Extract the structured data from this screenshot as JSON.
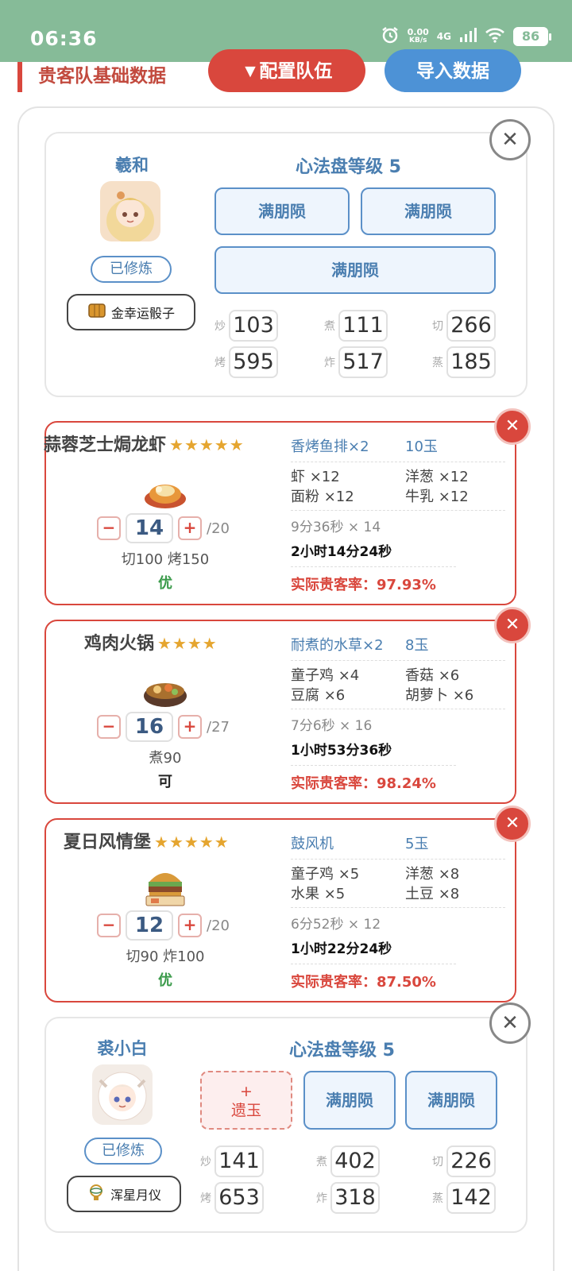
{
  "status_bar": {
    "time": "06:36",
    "net_speed_value": "0.00",
    "net_speed_unit": "KB/s",
    "network": "4G",
    "battery": "86"
  },
  "header": {
    "title": "贵客队基础数据",
    "config_button": "▼配置队伍",
    "import_button": "导入数据"
  },
  "chefs": [
    {
      "name": "羲和",
      "cultivated_label": "已修炼",
      "item": "金幸运骰子",
      "level_label": "心法盘等级 5",
      "slots": [
        "满朋陨",
        "满朋陨",
        "满朋陨"
      ],
      "stats": [
        {
          "label": "炒",
          "value": "103"
        },
        {
          "label": "煮",
          "value": "111"
        },
        {
          "label": "切",
          "value": "266"
        },
        {
          "label": "烤",
          "value": "595"
        },
        {
          "label": "炸",
          "value": "517"
        },
        {
          "label": "蒸",
          "value": "185"
        }
      ]
    },
    {
      "name": "裘小白",
      "cultivated_label": "已修炼",
      "item": "浑星月仪",
      "level_label": "心法盘等级 5",
      "empty_slot": {
        "plus": "+",
        "label": "遗玉"
      },
      "slots": [
        "满朋陨",
        "满朋陨"
      ],
      "stats": [
        {
          "label": "炒",
          "value": "141"
        },
        {
          "label": "煮",
          "value": "402"
        },
        {
          "label": "切",
          "value": "226"
        },
        {
          "label": "烤",
          "value": "653"
        },
        {
          "label": "炸",
          "value": "318"
        },
        {
          "label": "蒸",
          "value": "142"
        }
      ]
    }
  ],
  "recipes": [
    {
      "name": "蒜蓉芝士焗龙虾",
      "stars": "★★★★★",
      "quantity": "14",
      "max": "/20",
      "requirement": "切100 烤150",
      "grade": "优",
      "grade_color": "#3a9a4a",
      "material": "香烤鱼排×2",
      "jade": "10玉",
      "ingredients": [
        "虾 ×12",
        "洋葱 ×12",
        "面粉 ×12",
        "牛乳 ×12"
      ],
      "time_each": "9分36秒 × 14",
      "time_total": "2小时14分24秒",
      "rate": "实际贵客率：97.93%"
    },
    {
      "name": "鸡肉火锅",
      "stars": "★★★★",
      "quantity": "16",
      "max": "/27",
      "requirement": "煮90",
      "grade": "可",
      "grade_color": "#222222",
      "material": "耐煮的水草×2",
      "jade": "8玉",
      "ingredients": [
        "童子鸡 ×4",
        "香菇 ×6",
        "豆腐 ×6",
        "胡萝卜 ×6"
      ],
      "time_each": "7分6秒 × 16",
      "time_total": "1小时53分36秒",
      "rate": "实际贵客率：98.24%"
    },
    {
      "name": "夏日风情堡",
      "stars": "★★★★★",
      "quantity": "12",
      "max": "/20",
      "requirement": "切90 炸100",
      "grade": "优",
      "grade_color": "#3a9a4a",
      "material": "鼓风机",
      "jade": "5玉",
      "ingredients": [
        "童子鸡 ×5",
        "洋葱 ×8",
        "水果 ×5",
        "土豆 ×8"
      ],
      "time_each": "6分52秒 × 12",
      "time_total": "1小时22分24秒",
      "rate": "实际贵客率：87.50%"
    }
  ],
  "controls": {
    "minus": "−",
    "plus": "+",
    "close": "✕"
  }
}
